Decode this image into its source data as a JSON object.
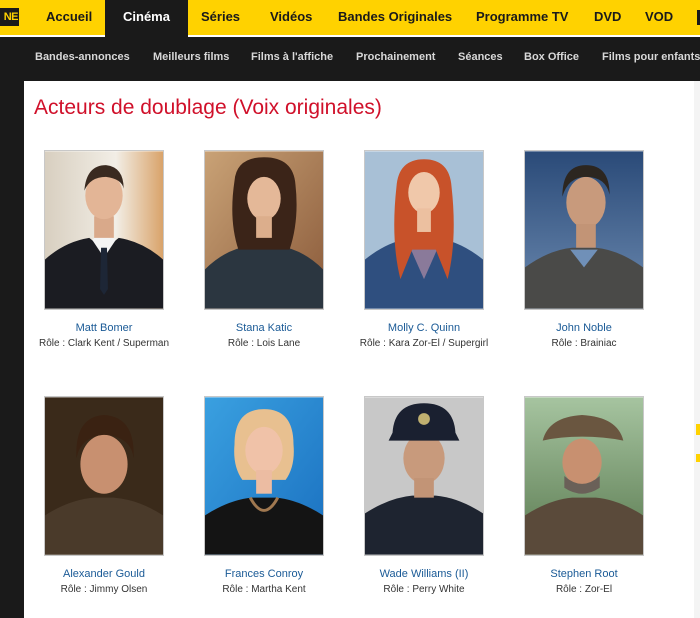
{
  "logo_text": "NE",
  "top_nav": [
    "Accueil",
    "Cinéma",
    "Séries",
    "Vidéos",
    "Bandes Originales",
    "Programme TV",
    "DVD",
    "VOD"
  ],
  "sub_nav": [
    "Bandes-annonces",
    "Meilleurs films",
    "Films à l'affiche",
    "Prochainement",
    "Séances",
    "Box Office",
    "Films pour enfants"
  ],
  "page_title": "Acteurs de doublage (Voix originales)",
  "actors": [
    {
      "name": "Matt Bomer",
      "role": "Rôle : Clark Kent / Superman"
    },
    {
      "name": "Stana Katic",
      "role": "Rôle : Lois Lane"
    },
    {
      "name": "Molly C. Quinn",
      "role": "Rôle : Kara Zor-El / Supergirl"
    },
    {
      "name": "John Noble",
      "role": "Rôle : Brainiac"
    },
    {
      "name": "Alexander Gould",
      "role": "Rôle : Jimmy Olsen"
    },
    {
      "name": "Frances Conroy",
      "role": "Rôle : Martha Kent"
    },
    {
      "name": "Wade Williams (II)",
      "role": "Rôle : Perry White"
    },
    {
      "name": "Stephen Root",
      "role": "Rôle : Zor-El"
    }
  ]
}
